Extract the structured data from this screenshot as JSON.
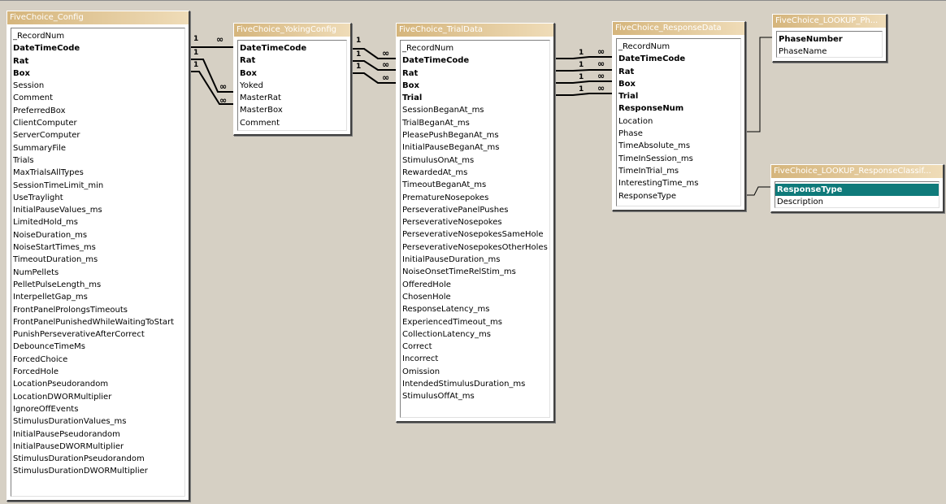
{
  "tables": {
    "config": {
      "title": "FiveChoice_Config",
      "fields": [
        {
          "name": "_RecordNum",
          "key": false
        },
        {
          "name": "DateTimeCode",
          "key": true
        },
        {
          "name": "Rat",
          "key": true
        },
        {
          "name": "Box",
          "key": true
        },
        {
          "name": "Session",
          "key": false
        },
        {
          "name": "Comment",
          "key": false
        },
        {
          "name": "PreferredBox",
          "key": false
        },
        {
          "name": "ClientComputer",
          "key": false
        },
        {
          "name": "ServerComputer",
          "key": false
        },
        {
          "name": "SummaryFile",
          "key": false
        },
        {
          "name": "Trials",
          "key": false
        },
        {
          "name": "MaxTrialsAllTypes",
          "key": false
        },
        {
          "name": "SessionTimeLimit_min",
          "key": false
        },
        {
          "name": "UseTraylight",
          "key": false
        },
        {
          "name": "InitialPauseValues_ms",
          "key": false
        },
        {
          "name": "LimitedHold_ms",
          "key": false
        },
        {
          "name": "NoiseDuration_ms",
          "key": false
        },
        {
          "name": "NoiseStartTimes_ms",
          "key": false
        },
        {
          "name": "TimeoutDuration_ms",
          "key": false
        },
        {
          "name": "NumPellets",
          "key": false
        },
        {
          "name": "PelletPulseLength_ms",
          "key": false
        },
        {
          "name": "InterpelletGap_ms",
          "key": false
        },
        {
          "name": "FrontPanelProlongsTimeouts",
          "key": false
        },
        {
          "name": "FrontPanelPunishedWhileWaitingToStart",
          "key": false
        },
        {
          "name": "PunishPerseverativeAfterCorrect",
          "key": false
        },
        {
          "name": "DebounceTimeMs",
          "key": false
        },
        {
          "name": "ForcedChoice",
          "key": false
        },
        {
          "name": "ForcedHole",
          "key": false
        },
        {
          "name": "LocationPseudorandom",
          "key": false
        },
        {
          "name": "LocationDWORMultiplier",
          "key": false
        },
        {
          "name": "IgnoreOffEvents",
          "key": false
        },
        {
          "name": "StimulusDurationValues_ms",
          "key": false
        },
        {
          "name": "InitialPausePseudorandom",
          "key": false
        },
        {
          "name": "InitialPauseDWORMultiplier",
          "key": false
        },
        {
          "name": "StimulusDurationPseudorandom",
          "key": false
        },
        {
          "name": "StimulusDurationDWORMultiplier",
          "key": false
        }
      ]
    },
    "yoking": {
      "title": "FiveChoice_YokingConfig",
      "fields": [
        {
          "name": "DateTimeCode",
          "key": true
        },
        {
          "name": "Rat",
          "key": true
        },
        {
          "name": "Box",
          "key": true
        },
        {
          "name": "Yoked",
          "key": false
        },
        {
          "name": "MasterRat",
          "key": false
        },
        {
          "name": "MasterBox",
          "key": false
        },
        {
          "name": "Comment",
          "key": false
        }
      ]
    },
    "trial": {
      "title": "FiveChoice_TrialData",
      "fields": [
        {
          "name": "_RecordNum",
          "key": false
        },
        {
          "name": "DateTimeCode",
          "key": true
        },
        {
          "name": "Rat",
          "key": true
        },
        {
          "name": "Box",
          "key": true
        },
        {
          "name": "Trial",
          "key": true
        },
        {
          "name": "SessionBeganAt_ms",
          "key": false
        },
        {
          "name": "TrialBeganAt_ms",
          "key": false
        },
        {
          "name": "PleasePushBeganAt_ms",
          "key": false
        },
        {
          "name": "InitialPauseBeganAt_ms",
          "key": false
        },
        {
          "name": "StimulusOnAt_ms",
          "key": false
        },
        {
          "name": "RewardedAt_ms",
          "key": false
        },
        {
          "name": "TimeoutBeganAt_ms",
          "key": false
        },
        {
          "name": "PrematureNosepokes",
          "key": false
        },
        {
          "name": "PerseverativePanelPushes",
          "key": false
        },
        {
          "name": "PerseverativeNosepokes",
          "key": false
        },
        {
          "name": "PerseverativeNosepokesSameHole",
          "key": false
        },
        {
          "name": "PerseverativeNosepokesOtherHoles",
          "key": false
        },
        {
          "name": "InitialPauseDuration_ms",
          "key": false
        },
        {
          "name": "NoiseOnsetTimeRelStim_ms",
          "key": false
        },
        {
          "name": "OfferedHole",
          "key": false
        },
        {
          "name": "ChosenHole",
          "key": false
        },
        {
          "name": "ResponseLatency_ms",
          "key": false
        },
        {
          "name": "ExperiencedTimeout_ms",
          "key": false
        },
        {
          "name": "CollectionLatency_ms",
          "key": false
        },
        {
          "name": "Correct",
          "key": false
        },
        {
          "name": "Incorrect",
          "key": false
        },
        {
          "name": "Omission",
          "key": false
        },
        {
          "name": "IntendedStimulusDuration_ms",
          "key": false
        },
        {
          "name": "StimulusOffAt_ms",
          "key": false
        }
      ]
    },
    "response": {
      "title": "FiveChoice_ResponseData",
      "fields": [
        {
          "name": "_RecordNum",
          "key": false
        },
        {
          "name": "DateTimeCode",
          "key": true
        },
        {
          "name": "Rat",
          "key": true
        },
        {
          "name": "Box",
          "key": true
        },
        {
          "name": "Trial",
          "key": true
        },
        {
          "name": "ResponseNum",
          "key": true
        },
        {
          "name": "Location",
          "key": false
        },
        {
          "name": "Phase",
          "key": false
        },
        {
          "name": "TimeAbsolute_ms",
          "key": false
        },
        {
          "name": "TimeInSession_ms",
          "key": false
        },
        {
          "name": "TimeInTrial_ms",
          "key": false
        },
        {
          "name": "InterestingTime_ms",
          "key": false
        },
        {
          "name": "ResponseType",
          "key": false
        }
      ]
    },
    "lookup_phase": {
      "title": "FiveChoice_LOOKUP_Ph...",
      "fields": [
        {
          "name": "PhaseNumber",
          "key": true
        },
        {
          "name": "PhaseName",
          "key": false
        }
      ]
    },
    "lookup_response": {
      "title": "FiveChoice_LOOKUP_ResponseClassif...",
      "fields": [
        {
          "name": "ResponseType",
          "key": true,
          "selected": true
        },
        {
          "name": "Description",
          "key": false
        }
      ]
    }
  },
  "relationships": {
    "one_label": "1",
    "many_label": "∞"
  },
  "colors": {
    "workspace": "#d6d0c4",
    "title_gradient_start": "#d5b57c",
    "selected_field": "#0f7a7a"
  }
}
